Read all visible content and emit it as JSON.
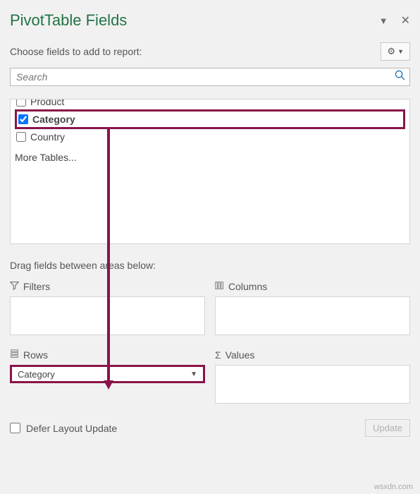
{
  "header": {
    "title": "PivotTable Fields"
  },
  "subheader": {
    "text": "Choose fields to add to report:"
  },
  "search": {
    "placeholder": "Search"
  },
  "fields": {
    "product": "Product",
    "category": "Category",
    "country": "Country",
    "more": "More Tables..."
  },
  "drag_text": "Drag fields between areas below:",
  "areas": {
    "filters": "Filters",
    "columns": "Columns",
    "rows": "Rows",
    "values": "Values"
  },
  "row_field": {
    "label": "Category"
  },
  "footer": {
    "defer": "Defer Layout Update",
    "update": "Update"
  },
  "watermark": "wsxdn.com",
  "highlight_color": "#891449"
}
